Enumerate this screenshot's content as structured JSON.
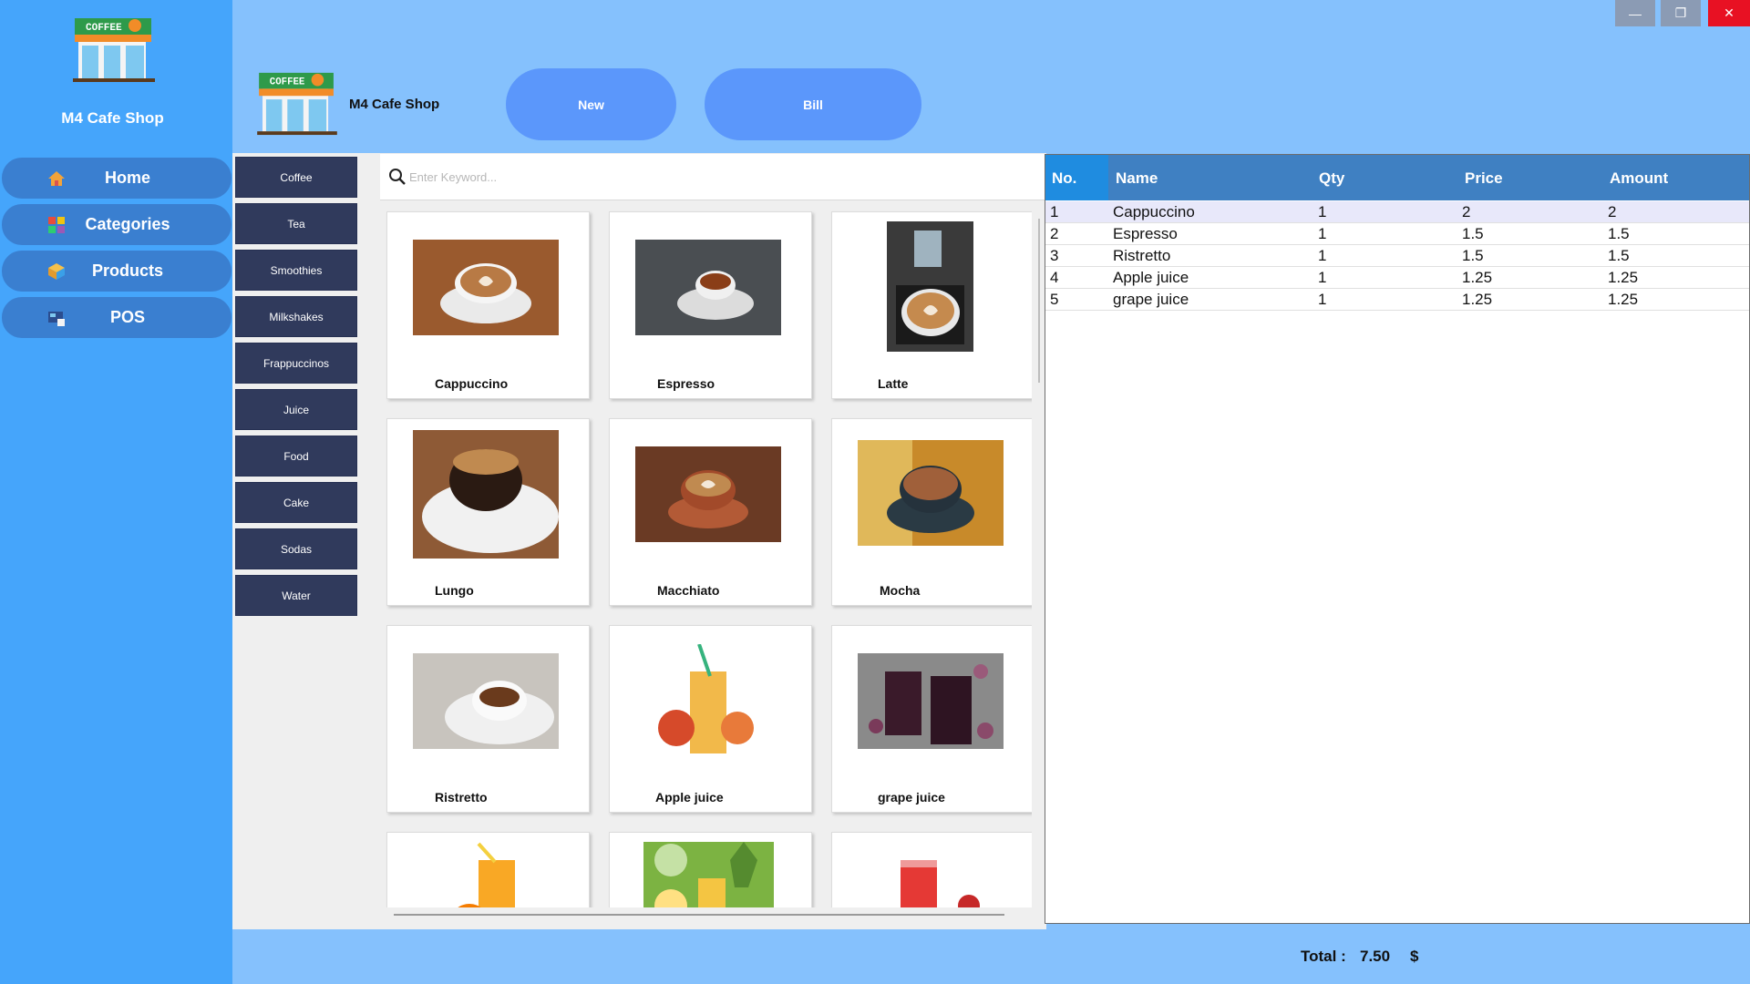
{
  "app": {
    "title": "M4 Cafe Shop"
  },
  "sidebar": {
    "items": [
      {
        "label": "Home",
        "icon": "home-icon"
      },
      {
        "label": "Categories",
        "icon": "categories-icon"
      },
      {
        "label": "Products",
        "icon": "products-icon"
      },
      {
        "label": "POS",
        "icon": "pos-icon"
      }
    ]
  },
  "header": {
    "new_label": "New",
    "bill_label": "Bill"
  },
  "categories": [
    "Coffee",
    "Tea",
    "Smoothies",
    "Milkshakes",
    "Frappuccinos",
    "Juice",
    "Food",
    "Cake",
    "Sodas",
    "Water"
  ],
  "search": {
    "placeholder": "Enter Keyword..."
  },
  "products": [
    "Cappuccino",
    "Espresso",
    "Latte",
    "Lungo",
    "Macchiato",
    "Mocha",
    "Ristretto",
    "Apple juice",
    "grape juice",
    "",
    "",
    ""
  ],
  "order": {
    "columns": [
      "No.",
      "Name",
      "Qty",
      "Price",
      "Amount"
    ],
    "rows": [
      [
        "1",
        "Cappuccino",
        "1",
        "2",
        "2"
      ],
      [
        "2",
        "Espresso",
        "1",
        "1.5",
        "1.5"
      ],
      [
        "3",
        "Ristretto",
        "1",
        "1.5",
        "1.5"
      ],
      [
        "4",
        "Apple juice",
        "1",
        "1.25",
        "1.25"
      ],
      [
        "5",
        "grape juice",
        "1",
        "1.25",
        "1.25"
      ]
    ]
  },
  "footer": {
    "total_label": "Total :",
    "total_value": "7.50",
    "currency": "$"
  },
  "colors": {
    "sidebar": "#45a5fb",
    "nav_button": "#3a7fd0",
    "pill": "#5b97fb",
    "category": "#303a5c",
    "table_header": "#3f80c2",
    "close": "#e81123"
  }
}
